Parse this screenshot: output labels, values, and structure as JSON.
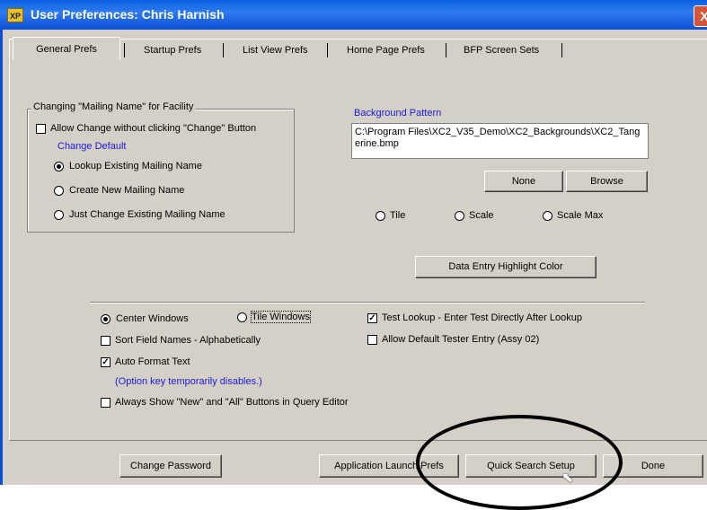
{
  "window": {
    "title": "User Preferences: Chris Harnish",
    "app_icon_text": "XP",
    "close_symbol": "X"
  },
  "tabs": [
    "General Prefs",
    "Startup Prefs",
    "List View Prefs",
    "Home Page Prefs",
    "BFP Screen Sets"
  ],
  "mailing": {
    "group_title": "Changing \"Mailing Name\" for Facility",
    "allow_change_label": "Allow Change without clicking \"Change\" Button",
    "change_default_label": "Change Default",
    "options": [
      "Lookup Existing Mailing Name",
      "Create New Mailing Name",
      "Just Change Existing Mailing Name"
    ]
  },
  "background": {
    "label": "Background Pattern",
    "path": "C:\\Program Files\\XC2_V35_Demo\\XC2_Backgrounds\\XC2_Tangerine.bmp",
    "none_button": "None",
    "browse_button": "Browse",
    "options": [
      "Tile",
      "Scale",
      "Scale Max"
    ]
  },
  "highlight_button": "Data Entry Highlight Color",
  "window_options": {
    "center": "Center Windows",
    "tile": "Tile Windows",
    "sort_fields": "Sort Field Names - Alphabetically",
    "auto_format": "Auto Format Text",
    "option_note": "(Option key temporarily disables.)",
    "always_show": "Always Show \"New\" and \"All\" Buttons in Query Editor",
    "test_lookup": "Test Lookup - Enter Test Directly After Lookup",
    "allow_default_tester": "Allow Default Tester Entry (Assy 02)",
    "check_mark": "✓"
  },
  "footer": {
    "change_password": "Change Password",
    "app_launch_prefs": "Application Launch Prefs",
    "quick_search_setup": "Quick Search Setup",
    "done": "Done"
  },
  "cursor_glyph": "⬉"
}
